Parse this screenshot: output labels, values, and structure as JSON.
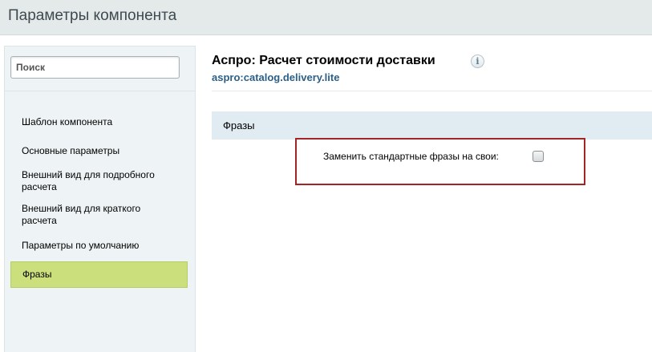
{
  "header": {
    "title": "Параметры компонента"
  },
  "sidebar": {
    "search_placeholder": "Поиск",
    "items": [
      {
        "label": "Шаблон компонента"
      },
      {
        "label": "Основные параметры"
      },
      {
        "label": "Внешний вид для подробного расчета"
      },
      {
        "label": "Внешний вид для краткого расчета"
      },
      {
        "label": "Параметры по умолчанию"
      },
      {
        "label": "Фразы",
        "active": true
      }
    ]
  },
  "main": {
    "title": "Аспро: Расчет стоимости доставки",
    "info_icon": "info-icon",
    "code": "aspro:catalog.delivery.lite",
    "section": {
      "title": "Фразы",
      "option": {
        "label": "Заменить стандартные фразы на свои:",
        "checked": false
      }
    }
  },
  "colors": {
    "active_item": "#cbe07c",
    "section_bg": "#e0ebf2",
    "highlight_border": "#a32424",
    "code_text": "#2c5f87"
  }
}
